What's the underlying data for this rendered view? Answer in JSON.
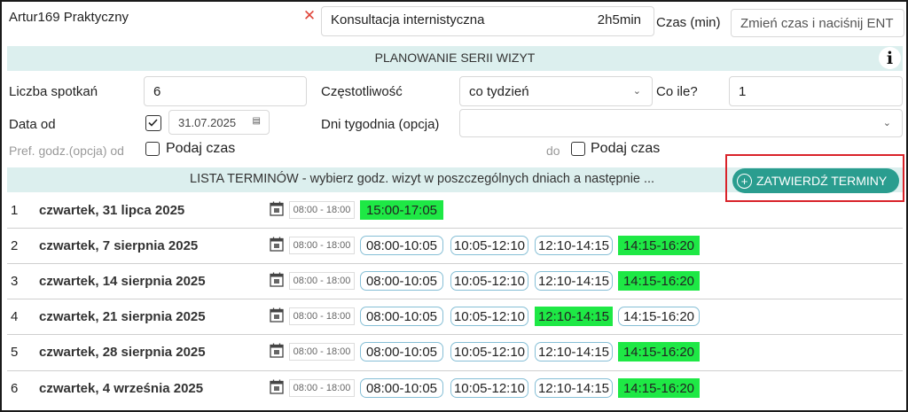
{
  "header": {
    "patient": "Artur169 Praktyczny",
    "service_value": "Konsultacja internistyczna",
    "service_duration": "2h5min",
    "duration_label": "Czas (min)",
    "duration_placeholder": "Zmień czas i naciśnij ENT"
  },
  "planning": {
    "title": "PLANOWANIE SERII WIZYT",
    "count_label": "Liczba spotkań",
    "count_value": "6",
    "frequency_label": "Częstotliwość",
    "frequency_value": "co tydzień",
    "every_label": "Co ile?",
    "every_value": "1",
    "date_from_label": "Data od",
    "date_from_value": "31.07.2025",
    "weekdays_label": "Dni tygodnia (opcja)",
    "weekdays_value": "",
    "pref_from_label": "Pref. godz.(opcja) od",
    "pref_from_check_label": "Podaj czas",
    "pref_to_label": "do",
    "pref_to_check_label": "Podaj czas"
  },
  "list": {
    "title": "LISTA TERMINÓW  -  wybierz godz. wizyt w poszczególnych dniach a następnie ...",
    "confirm_button": "ZATWIERDŹ TERMINY",
    "rows": [
      {
        "num": "1",
        "date": "czwartek, 31 lipca 2025",
        "range": "08:00 - 18:00",
        "slots": [
          {
            "label": "15:00-17:05",
            "selected": true
          }
        ]
      },
      {
        "num": "2",
        "date": "czwartek, 7 sierpnia 2025",
        "range": "08:00 - 18:00",
        "slots": [
          {
            "label": "08:00-10:05",
            "selected": false
          },
          {
            "label": "10:05-12:10",
            "selected": false
          },
          {
            "label": "12:10-14:15",
            "selected": false
          },
          {
            "label": "14:15-16:20",
            "selected": true
          }
        ]
      },
      {
        "num": "3",
        "date": "czwartek, 14 sierpnia 2025",
        "range": "08:00 - 18:00",
        "slots": [
          {
            "label": "08:00-10:05",
            "selected": false
          },
          {
            "label": "10:05-12:10",
            "selected": false
          },
          {
            "label": "12:10-14:15",
            "selected": false
          },
          {
            "label": "14:15-16:20",
            "selected": true
          }
        ]
      },
      {
        "num": "4",
        "date": "czwartek, 21 sierpnia 2025",
        "range": "08:00 - 18:00",
        "slots": [
          {
            "label": "08:00-10:05",
            "selected": false
          },
          {
            "label": "10:05-12:10",
            "selected": false
          },
          {
            "label": "12:10-14:15",
            "selected": true
          },
          {
            "label": "14:15-16:20",
            "selected": false
          }
        ]
      },
      {
        "num": "5",
        "date": "czwartek, 28 sierpnia 2025",
        "range": "08:00 - 18:00",
        "slots": [
          {
            "label": "08:00-10:05",
            "selected": false
          },
          {
            "label": "10:05-12:10",
            "selected": false
          },
          {
            "label": "12:10-14:15",
            "selected": false
          },
          {
            "label": "14:15-16:20",
            "selected": true
          }
        ]
      },
      {
        "num": "6",
        "date": "czwartek, 4 września 2025",
        "range": "08:00 - 18:00",
        "slots": [
          {
            "label": "08:00-10:05",
            "selected": false
          },
          {
            "label": "10:05-12:10",
            "selected": false
          },
          {
            "label": "12:10-14:15",
            "selected": false
          },
          {
            "label": "14:15-16:20",
            "selected": true
          }
        ]
      }
    ]
  },
  "colors": {
    "band": "#dcefee",
    "accent_button": "#2a9d8f",
    "selected_slot": "#1ee845",
    "highlight_box": "#d9232a"
  }
}
